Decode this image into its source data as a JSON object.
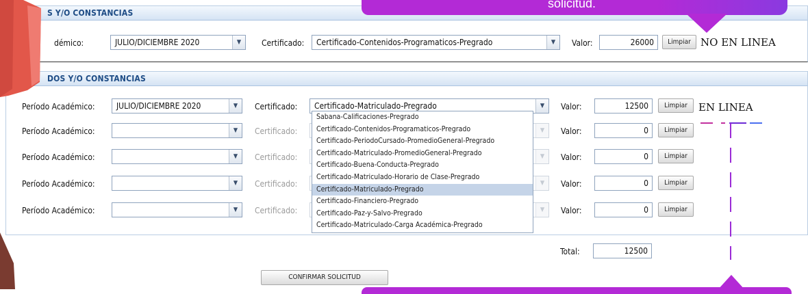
{
  "colors": {
    "accent": "#1f4d86",
    "callout": "#b32ad6",
    "decoration": "#e2574a"
  },
  "top_callout": {
    "text": "solicitud."
  },
  "panel1": {
    "title": "CERTIFICADOS Y/O CONSTANCIAS",
    "title_visible": "S Y/O CONSTANCIAS",
    "row": {
      "periodo_label": "Período Académico:",
      "periodo_label_visible": "démico:",
      "periodo_value": "JULIO/DICIEMBRE 2020",
      "cert_label": "Certificado:",
      "cert_value": "Certificado-Contenidos-Programaticos-Pregrado",
      "valor_label": "Valor:",
      "valor_value": "26000",
      "limpiar_label": "Limpiar",
      "status": "NO EN LINEA"
    }
  },
  "panel2": {
    "title": "CERTIFICADOS Y/O CONSTANCIAS",
    "title_visible": "DOS Y/O CONSTANCIAS",
    "status": "EN LINEA",
    "rows": [
      {
        "periodo_label": "Período Académico:",
        "periodo_value": "JULIO/DICIEMBRE 2020",
        "cert_label": "Certificado:",
        "cert_value": "Certificado-Matriculado-Pregrado",
        "valor_label": "Valor:",
        "valor_value": "12500",
        "limpiar_label": "Limpiar"
      },
      {
        "periodo_label": "Período Académico:",
        "periodo_value": "",
        "cert_label": "Certificado:",
        "cert_value": "",
        "valor_label": "Valor:",
        "valor_value": "0",
        "limpiar_label": "Limpiar"
      },
      {
        "periodo_label": "Período Académico:",
        "periodo_value": "",
        "cert_label": "Certificado:",
        "cert_value": "",
        "valor_label": "Valor:",
        "valor_value": "0",
        "limpiar_label": "Limpiar"
      },
      {
        "periodo_label": "Período Académico:",
        "periodo_value": "",
        "cert_label": "Certificado:",
        "cert_value": "",
        "valor_label": "Valor:",
        "valor_value": "0",
        "limpiar_label": "Limpiar"
      },
      {
        "periodo_label": "Período Académico:",
        "periodo_value": "",
        "cert_label": "Certificado:",
        "cert_value": "",
        "valor_label": "Valor:",
        "valor_value": "0",
        "limpiar_label": "Limpiar"
      }
    ],
    "dropdown_options": [
      "Sabana-Calificaciones-Pregrado",
      "Certificado-Contenidos-Programaticos-Pregrado",
      "Certificado-PeriodoCursado-PromedioGeneral-Pregrado",
      "Certificado-Matriculado-PromedioGeneral-Pregrado",
      "Certificado-Buena-Conducta-Pregrado",
      "Certificado-Matriculado-Horario de Clase-Pregrado",
      "Certificado-Matriculado-Pregrado",
      "Certificado-Financiero-Pregrado",
      "Certificado-Paz-y-Salvo-Pregrado",
      "Certificado-Matriculado-Carga Académica-Pregrado"
    ],
    "dropdown_selected": "Certificado-Matriculado-Pregrado",
    "total_label": "Total:",
    "total_value": "12500"
  },
  "confirm_button": "CONFIRMAR SOLICITUD"
}
